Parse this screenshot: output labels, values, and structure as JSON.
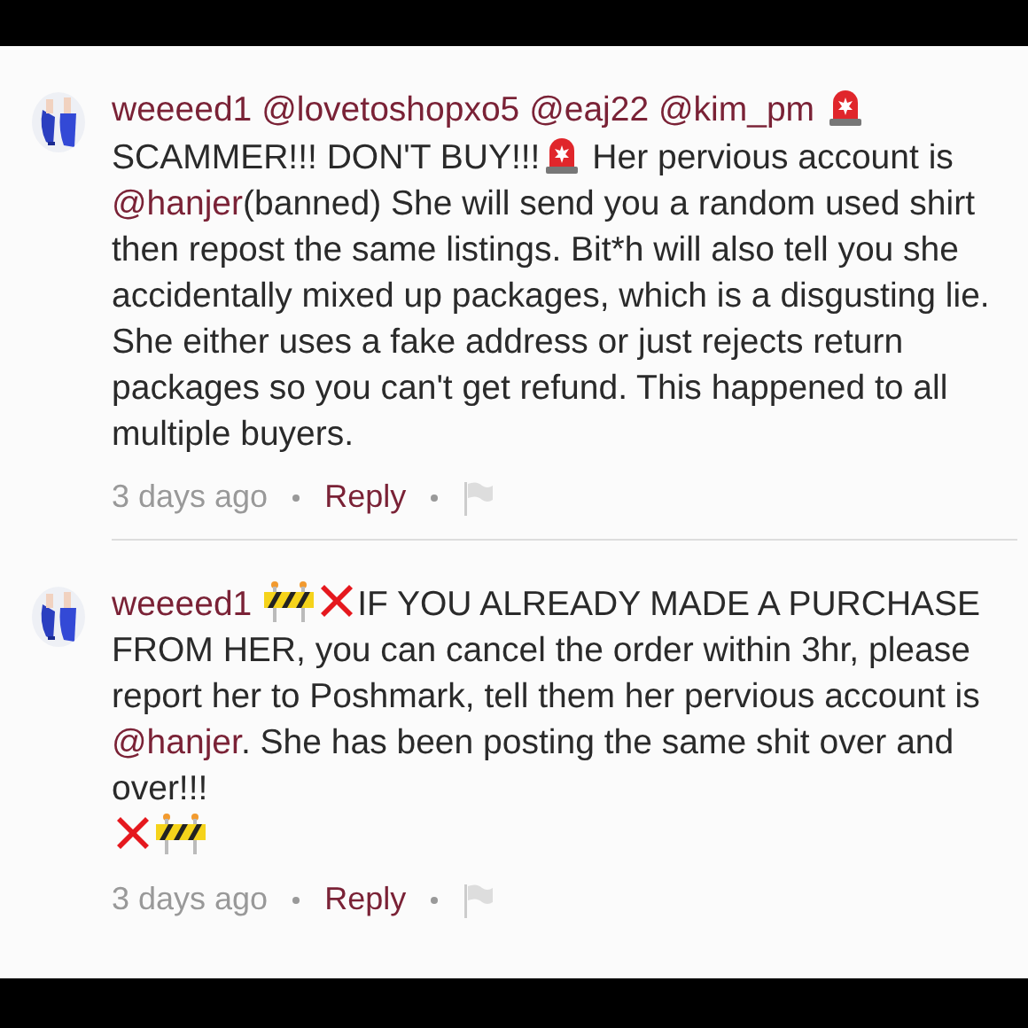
{
  "comments": [
    {
      "author": "weeeed1",
      "body": [
        {
          "kind": "mention",
          "text": "@lovetoshopxo5"
        },
        {
          "kind": "mention",
          "text": "@eaj22"
        },
        {
          "kind": "mention",
          "text": "@kim_pm"
        },
        {
          "kind": "siren"
        },
        {
          "kind": "text",
          "text": " SCAMMER!!! DON'T BUY!!!"
        },
        {
          "kind": "siren"
        },
        {
          "kind": "text",
          "text": " Her pervious account is "
        },
        {
          "kind": "mention",
          "text": "@hanjer"
        },
        {
          "kind": "text",
          "text": "(banned) She will send you a random used shirt then repost the same listings. Bit*h will also tell you she accidentally mixed up packages, which is a disgusting lie. She either uses a fake address or just rejects return packages so you can't get refund. This happened to all multiple buyers."
        }
      ],
      "time": "3 days ago",
      "reply": "Reply"
    },
    {
      "author": "weeeed1",
      "body": [
        {
          "kind": "barrier"
        },
        {
          "kind": "cross"
        },
        {
          "kind": "text",
          "text": "IF YOU ALREADY MADE A PURCHASE FROM HER, you can cancel the order within 3hr, please report her to Poshmark, tell them her pervious account is "
        },
        {
          "kind": "mention",
          "text": "@hanjer"
        },
        {
          "kind": "text",
          "text": ". She has been posting the same shit over and over!!!"
        },
        {
          "kind": "break"
        },
        {
          "kind": "cross"
        },
        {
          "kind": "barrier"
        }
      ],
      "time": "3 days ago",
      "reply": "Reply"
    }
  ]
}
